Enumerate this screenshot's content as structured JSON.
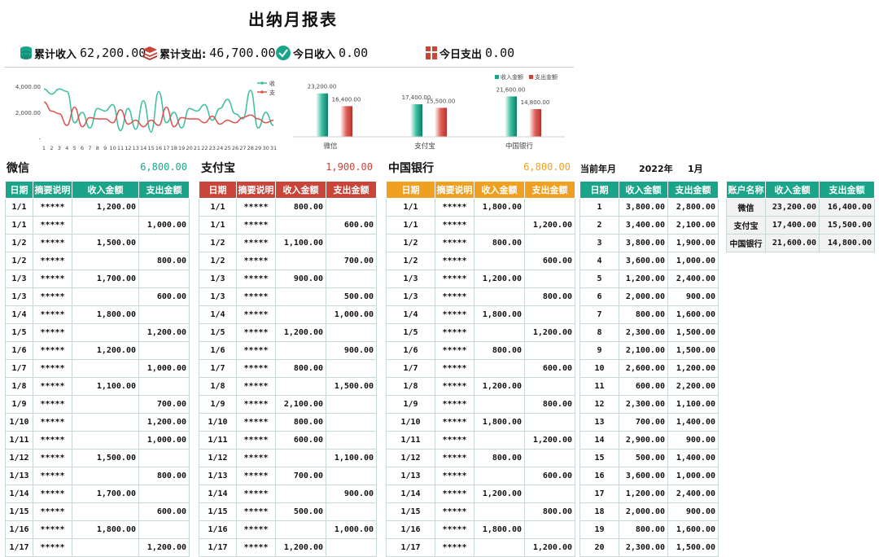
{
  "title": "出纳月报表",
  "summary": {
    "cum_income_label": "累计收入",
    "cum_income_value": "62,200.00",
    "cum_expense_label": "累计支出:",
    "cum_expense_value": "46,700.00",
    "today_income_label": "今日收入",
    "today_income_value": "0.00",
    "today_expense_label": "今日支出",
    "today_expense_value": "0.00"
  },
  "colors": {
    "green": "#1aa58a",
    "red": "#c9453a",
    "orange": "#f0a020",
    "line_green": "#3cbfa0",
    "line_red": "#d9534f"
  },
  "icons": [
    "coins-icon",
    "stack-icon",
    "check-circle-icon",
    "gift-icon"
  ],
  "month_label": {
    "label": "当前年月",
    "year": "2022年",
    "month": "1月"
  },
  "columns": {
    "date": "日期",
    "desc": "摘要说明",
    "income": "收入金额",
    "expense": "支出金额",
    "account": "账户名称"
  },
  "accounts": [
    {
      "name": "微信",
      "balance": "6,800.00",
      "rows": [
        [
          "1/1",
          "*****",
          "1,200.00",
          ""
        ],
        [
          "1/1",
          "*****",
          "",
          "1,000.00"
        ],
        [
          "1/2",
          "*****",
          "1,500.00",
          ""
        ],
        [
          "1/2",
          "*****",
          "",
          "800.00"
        ],
        [
          "1/3",
          "*****",
          "1,700.00",
          ""
        ],
        [
          "1/3",
          "*****",
          "",
          "600.00"
        ],
        [
          "1/4",
          "*****",
          "1,800.00",
          ""
        ],
        [
          "1/5",
          "*****",
          "",
          "1,200.00"
        ],
        [
          "1/6",
          "*****",
          "1,200.00",
          ""
        ],
        [
          "1/7",
          "*****",
          "",
          "1,000.00"
        ],
        [
          "1/8",
          "*****",
          "1,100.00",
          ""
        ],
        [
          "1/9",
          "*****",
          "",
          "700.00"
        ],
        [
          "1/10",
          "*****",
          "",
          "1,200.00"
        ],
        [
          "1/11",
          "*****",
          "",
          "1,000.00"
        ],
        [
          "1/12",
          "*****",
          "1,500.00",
          ""
        ],
        [
          "1/13",
          "*****",
          "",
          "800.00"
        ],
        [
          "1/14",
          "*****",
          "1,700.00",
          ""
        ],
        [
          "1/15",
          "*****",
          "",
          "600.00"
        ],
        [
          "1/16",
          "*****",
          "1,800.00",
          ""
        ],
        [
          "1/17",
          "*****",
          "",
          "1,200.00"
        ]
      ]
    },
    {
      "name": "支付宝",
      "balance": "1,900.00",
      "rows": [
        [
          "1/1",
          "*****",
          "800.00",
          ""
        ],
        [
          "1/1",
          "*****",
          "",
          "600.00"
        ],
        [
          "1/2",
          "*****",
          "1,100.00",
          ""
        ],
        [
          "1/2",
          "*****",
          "",
          "700.00"
        ],
        [
          "1/3",
          "*****",
          "900.00",
          ""
        ],
        [
          "1/3",
          "*****",
          "",
          "500.00"
        ],
        [
          "1/4",
          "*****",
          "",
          "1,000.00"
        ],
        [
          "1/5",
          "*****",
          "1,200.00",
          ""
        ],
        [
          "1/6",
          "*****",
          "",
          "900.00"
        ],
        [
          "1/7",
          "*****",
          "800.00",
          ""
        ],
        [
          "1/8",
          "*****",
          "",
          "1,500.00"
        ],
        [
          "1/9",
          "*****",
          "2,100.00",
          ""
        ],
        [
          "1/10",
          "*****",
          "800.00",
          ""
        ],
        [
          "1/11",
          "*****",
          "600.00",
          ""
        ],
        [
          "1/12",
          "*****",
          "",
          "1,100.00"
        ],
        [
          "1/13",
          "*****",
          "700.00",
          ""
        ],
        [
          "1/14",
          "*****",
          "",
          "900.00"
        ],
        [
          "1/15",
          "*****",
          "500.00",
          ""
        ],
        [
          "1/16",
          "*****",
          "",
          "1,000.00"
        ],
        [
          "1/17",
          "*****",
          "1,200.00",
          ""
        ]
      ]
    },
    {
      "name": "中国银行",
      "balance": "6,800.00",
      "rows": [
        [
          "1/1",
          "*****",
          "1,800.00",
          ""
        ],
        [
          "1/1",
          "*****",
          "",
          "1,200.00"
        ],
        [
          "1/2",
          "*****",
          "800.00",
          ""
        ],
        [
          "1/2",
          "*****",
          "",
          "600.00"
        ],
        [
          "1/3",
          "*****",
          "1,200.00",
          ""
        ],
        [
          "1/3",
          "*****",
          "",
          "800.00"
        ],
        [
          "1/4",
          "*****",
          "1,800.00",
          ""
        ],
        [
          "1/5",
          "*****",
          "",
          "1,200.00"
        ],
        [
          "1/6",
          "*****",
          "800.00",
          ""
        ],
        [
          "1/7",
          "*****",
          "",
          "600.00"
        ],
        [
          "1/8",
          "*****",
          "1,200.00",
          ""
        ],
        [
          "1/9",
          "*****",
          "",
          "800.00"
        ],
        [
          "1/10",
          "*****",
          "1,800.00",
          ""
        ],
        [
          "1/11",
          "*****",
          "",
          "1,200.00"
        ],
        [
          "1/12",
          "*****",
          "800.00",
          ""
        ],
        [
          "1/13",
          "*****",
          "",
          "600.00"
        ],
        [
          "1/14",
          "*****",
          "1,200.00",
          ""
        ],
        [
          "1/15",
          "*****",
          "",
          "800.00"
        ],
        [
          "1/16",
          "*****",
          "1,800.00",
          ""
        ],
        [
          "1/17",
          "*****",
          "",
          "1,200.00"
        ]
      ]
    }
  ],
  "daily": [
    [
      "1",
      "3,800.00",
      "2,800.00"
    ],
    [
      "2",
      "3,400.00",
      "2,100.00"
    ],
    [
      "3",
      "3,800.00",
      "1,900.00"
    ],
    [
      "4",
      "3,600.00",
      "1,000.00"
    ],
    [
      "5",
      "1,200.00",
      "2,400.00"
    ],
    [
      "6",
      "2,000.00",
      "900.00"
    ],
    [
      "7",
      "800.00",
      "1,600.00"
    ],
    [
      "8",
      "2,300.00",
      "1,500.00"
    ],
    [
      "9",
      "2,100.00",
      "1,500.00"
    ],
    [
      "10",
      "2,600.00",
      "1,200.00"
    ],
    [
      "11",
      "600.00",
      "2,200.00"
    ],
    [
      "12",
      "2,300.00",
      "1,100.00"
    ],
    [
      "13",
      "700.00",
      "1,400.00"
    ],
    [
      "14",
      "2,900.00",
      "900.00"
    ],
    [
      "15",
      "500.00",
      "1,400.00"
    ],
    [
      "16",
      "3,600.00",
      "1,000.00"
    ],
    [
      "17",
      "1,200.00",
      "2,400.00"
    ],
    [
      "18",
      "2,000.00",
      "900.00"
    ],
    [
      "19",
      "800.00",
      "1,600.00"
    ],
    [
      "20",
      "2,300.00",
      "1,500.00"
    ]
  ],
  "account_summary": [
    [
      "微信",
      "23,200.00",
      "16,400.00"
    ],
    [
      "支付宝",
      "17,400.00",
      "15,500.00"
    ],
    [
      "中国银行",
      "21,600.00",
      "14,800.00"
    ]
  ],
  "chart_data": [
    {
      "type": "line",
      "x": [
        1,
        2,
        3,
        4,
        5,
        6,
        7,
        8,
        9,
        10,
        11,
        12,
        13,
        14,
        15,
        16,
        17,
        18,
        19,
        20,
        21,
        22,
        23,
        24,
        25,
        26,
        27,
        28,
        29,
        30,
        31
      ],
      "xticks": [
        "1",
        "2",
        "3",
        "4",
        "5",
        "6",
        "7",
        "8",
        "9",
        "10",
        "11",
        "12",
        "13",
        "14",
        "15",
        "16",
        "17",
        "18",
        "19",
        "20",
        "21",
        "22",
        "23",
        "24",
        "25",
        "26",
        "27",
        "28",
        "29",
        "30",
        "31"
      ],
      "yticks": [
        "4,000.00",
        "2,000.00",
        "-"
      ],
      "ylim": [
        0,
        4500
      ],
      "series": [
        {
          "values": [
            3800,
            3400,
            3800,
            3600,
            1200,
            2000,
            800,
            2300,
            2100,
            2600,
            600,
            2300,
            700,
            2900,
            500,
            3600,
            1200,
            2000,
            800,
            2300,
            2100,
            2600,
            1400,
            2300,
            3000,
            1900,
            1500,
            3700,
            800,
            2000,
            1000
          ]
        },
        {
          "values": [
            2800,
            2100,
            1900,
            1000,
            2400,
            900,
            1600,
            1500,
            1500,
            1200,
            2200,
            1100,
            1400,
            900,
            1400,
            1000,
            2400,
            900,
            1600,
            1500,
            1500,
            1200,
            1700,
            1100,
            1400,
            1200,
            1600,
            1800,
            1500,
            1200,
            1400
          ]
        }
      ],
      "legend_labels": [
        "收",
        "支"
      ],
      "legend_position": "top-right"
    },
    {
      "type": "bar",
      "categories": [
        "微信",
        "支付宝",
        "中国银行"
      ],
      "series": [
        {
          "name": "收入金额",
          "values": [
            23200,
            17400,
            21600
          ],
          "labels": [
            "23,200.00",
            "17,400.00",
            "21,600.00"
          ]
        },
        {
          "name": "支出金额",
          "values": [
            16400,
            15500,
            14800
          ],
          "labels": [
            "16,400.00",
            "15,500.00",
            "14,800.00"
          ]
        }
      ],
      "ylim": [
        0,
        27000
      ],
      "legend_position": "top-right"
    }
  ]
}
